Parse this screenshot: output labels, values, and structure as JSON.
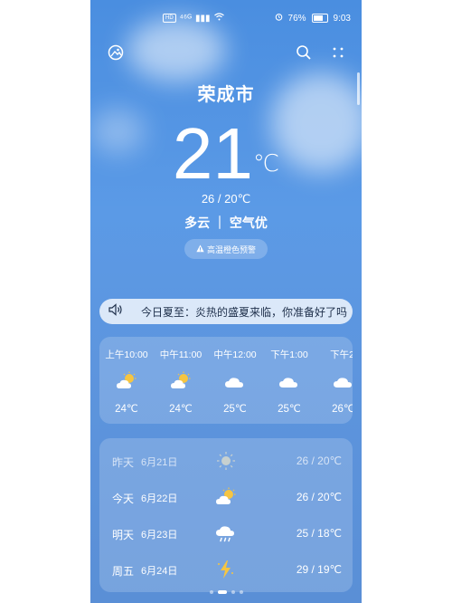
{
  "status": {
    "hd": "HD",
    "signal": "⁴⁶ᴳ",
    "battery": "76%",
    "time": "9:03"
  },
  "icons": [
    "gallery-icon",
    "search-icon",
    "more-icon"
  ],
  "city": "荣成市",
  "current": {
    "temp": "21",
    "unit": "℃",
    "range": "26 / 20℃",
    "condition": "多云 ｜ 空气优",
    "alert": "高温橙色预警"
  },
  "ticker": "今日夏至：炎热的盛夏来临，你准备好了吗",
  "hourly": [
    {
      "time": "上午10:00",
      "icon": "partly-cloudy-icon",
      "temp": "24℃"
    },
    {
      "time": "中午11:00",
      "icon": "partly-cloudy-icon",
      "temp": "24℃"
    },
    {
      "time": "中午12:00",
      "icon": "cloudy-icon",
      "temp": "25℃"
    },
    {
      "time": "下午1:00",
      "icon": "cloudy-icon",
      "temp": "25℃"
    },
    {
      "time": "下午2:",
      "icon": "cloudy-icon",
      "temp": "26℃"
    }
  ],
  "daily": [
    {
      "day": "昨天",
      "date": "6月21日",
      "icon": "sunny-icon",
      "range": "26 / 20℃"
    },
    {
      "day": "今天",
      "date": "6月22日",
      "icon": "partly-cloudy-icon",
      "range": "26 / 20℃"
    },
    {
      "day": "明天",
      "date": "6月23日",
      "icon": "rain-icon",
      "range": "25 / 18℃"
    },
    {
      "day": "周五",
      "date": "6月24日",
      "icon": "thunder-icon",
      "range": "29 / 19℃"
    }
  ],
  "colors": {
    "sky": "#4a8ee0",
    "sun": "#f5c542",
    "cloud": "#ffffff"
  }
}
